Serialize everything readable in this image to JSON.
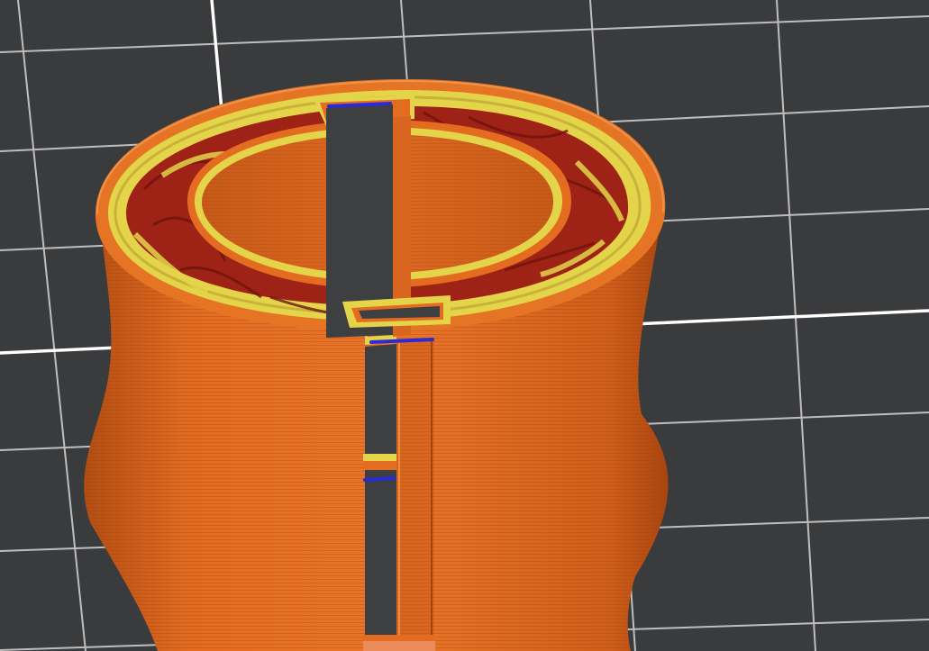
{
  "viewport": {
    "view": "sliced-preview-3d",
    "bed": "grid-plate"
  },
  "colors": {
    "bed_background": "#3a3b3d",
    "bed_tile": "#48494b",
    "grid_line": "#d8d8d8",
    "outer_wall": "#e46c21",
    "outer_wall_dark": "#b74f13",
    "inner_wall": "#e3d44a",
    "infill": "#a7241a",
    "infill_dark": "#7b170f",
    "travel": "#2a2ad8"
  },
  "feature_types": [
    {
      "name": "outer-wall",
      "color": "#e46c21"
    },
    {
      "name": "inner-wall",
      "color": "#e3d44a"
    },
    {
      "name": "sparse-infill",
      "color": "#a7241a"
    },
    {
      "name": "travel-retract",
      "color": "#2a2ad8"
    }
  ]
}
